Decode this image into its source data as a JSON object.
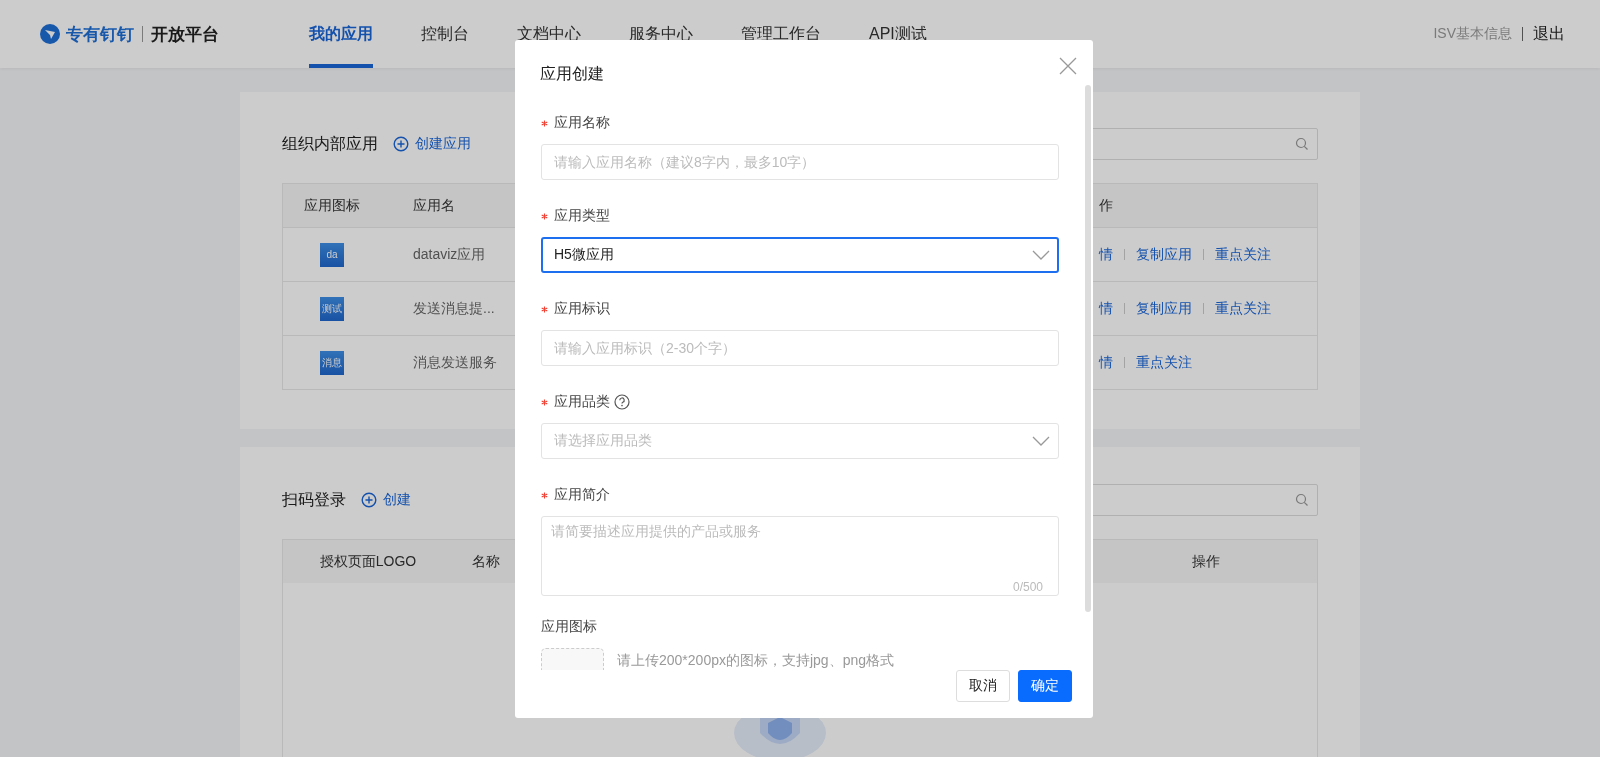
{
  "header": {
    "logo": "专有钉钉",
    "product": "开放平台",
    "nav": [
      {
        "label": "我的应用",
        "selected": true
      },
      {
        "label": "控制台",
        "selected": false
      },
      {
        "label": "文档中心",
        "selected": false
      },
      {
        "label": "服务中心",
        "selected": false
      },
      {
        "label": "管理工作台",
        "selected": false
      },
      {
        "label": "API测试",
        "selected": false
      }
    ],
    "links": [
      "ISV基本信息",
      "退出"
    ]
  },
  "sections": [
    {
      "title": "组织内部应用",
      "action": "创建应用",
      "columns": [
        "应用图标",
        "应用名",
        "作"
      ],
      "rows": [
        {
          "icon_text": "da",
          "name": "dataviz应用",
          "actions": [
            "情",
            "复制应用",
            "重点关注"
          ]
        },
        {
          "icon_text": "测试",
          "name": "发送消息提...",
          "actions": [
            "情",
            "复制应用",
            "重点关注"
          ]
        },
        {
          "icon_text": "消息",
          "name": "消息发送服务",
          "actions": [
            "情",
            "重点关注"
          ]
        }
      ]
    },
    {
      "title": "扫码登录",
      "action": "创建",
      "columns": [
        "授权页面LOGO",
        "名称",
        "操作"
      ]
    }
  ],
  "dialog": {
    "title": "应用创建",
    "fields": [
      {
        "kind": "input",
        "label": "应用名称",
        "required": true,
        "focused": false,
        "placeholder": "请输入应用名称（建议8字内，最多10字）"
      },
      {
        "kind": "select",
        "label": "应用类型",
        "required": true,
        "focused": true,
        "value": "H5微应用"
      },
      {
        "kind": "input",
        "label": "应用标识",
        "required": true,
        "focused": false,
        "placeholder": "请输入应用标识（2-30个字）"
      },
      {
        "kind": "select",
        "label": "应用品类",
        "required": true,
        "help": true,
        "focused": false,
        "placeholder": "请选择应用品类"
      },
      {
        "kind": "textarea",
        "label": "应用简介",
        "required": true,
        "focused": false,
        "placeholder": "请简要描述应用提供的产品或服务",
        "counter": "0/500"
      },
      {
        "kind": "upload",
        "label": "应用图标",
        "required": false,
        "hint": "请上传200*200px的图标，支持jpg、png格式"
      }
    ],
    "buttons": [
      {
        "label": "取消",
        "kind": "default"
      },
      {
        "label": "确定",
        "kind": "primary"
      }
    ]
  }
}
